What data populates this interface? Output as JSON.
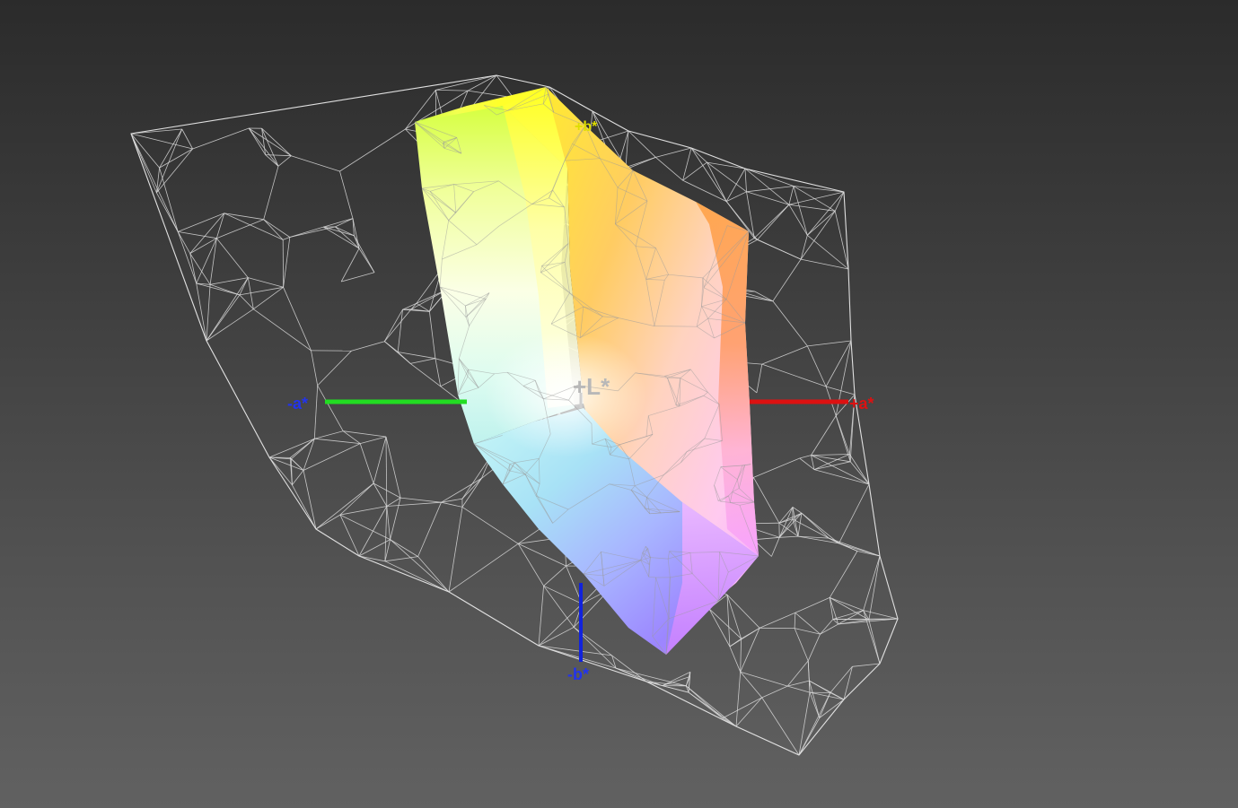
{
  "axes": {
    "neg_a": {
      "label": "-a*",
      "color": "#2233ee"
    },
    "pos_a": {
      "label": "+a*",
      "color": "#dd1111"
    },
    "neg_b": {
      "label": "-b*",
      "color": "#2233ee"
    },
    "pos_b": {
      "label": "+b*",
      "color": "#dddd00"
    },
    "pos_L": {
      "label": "+L*",
      "color": "#b8b8b8"
    }
  },
  "colors": {
    "background_top": "#2b2b2b",
    "background_bottom": "#616161",
    "wireframe": "#e6e6e6",
    "green_axis": "#22dd22",
    "red_axis": "#dd1111",
    "blue_axis": "#1122dd"
  }
}
